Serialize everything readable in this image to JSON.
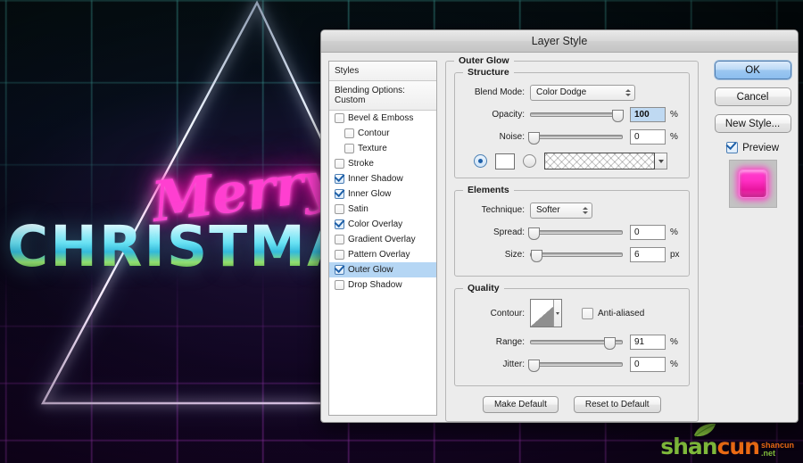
{
  "artwork": {
    "script_text": "Merry",
    "block_text": "CHRISTMAS",
    "colors": {
      "neon_pink": "#ff3fd0",
      "neon_cyan": "#5aebe1",
      "neon_purple": "#cd46eb"
    }
  },
  "watermark": {
    "part1": "shan",
    "part2": "cun",
    "domain_line1": "shancun",
    "domain_line2": ".net"
  },
  "dialog": {
    "title": "Layer Style",
    "styles_panel": {
      "header": "Styles",
      "blending_options": "Blending Options: Custom",
      "items": [
        {
          "label": "Bevel & Emboss",
          "checked": false,
          "indent": false,
          "selected": false
        },
        {
          "label": "Contour",
          "checked": false,
          "indent": true,
          "selected": false
        },
        {
          "label": "Texture",
          "checked": false,
          "indent": true,
          "selected": false
        },
        {
          "label": "Stroke",
          "checked": false,
          "indent": false,
          "selected": false
        },
        {
          "label": "Inner Shadow",
          "checked": true,
          "indent": false,
          "selected": false
        },
        {
          "label": "Inner Glow",
          "checked": true,
          "indent": false,
          "selected": false
        },
        {
          "label": "Satin",
          "checked": false,
          "indent": false,
          "selected": false
        },
        {
          "label": "Color Overlay",
          "checked": true,
          "indent": false,
          "selected": false
        },
        {
          "label": "Gradient Overlay",
          "checked": false,
          "indent": false,
          "selected": false
        },
        {
          "label": "Pattern Overlay",
          "checked": false,
          "indent": false,
          "selected": false
        },
        {
          "label": "Outer Glow",
          "checked": true,
          "indent": false,
          "selected": true
        },
        {
          "label": "Drop Shadow",
          "checked": false,
          "indent": false,
          "selected": false
        }
      ]
    },
    "effect": {
      "title": "Outer Glow",
      "structure": {
        "legend": "Structure",
        "blend_mode_label": "Blend Mode:",
        "blend_mode_value": "Color Dodge",
        "opacity_label": "Opacity:",
        "opacity_value": "100",
        "opacity_unit": "%",
        "noise_label": "Noise:",
        "noise_value": "0",
        "noise_unit": "%"
      },
      "elements": {
        "legend": "Elements",
        "technique_label": "Technique:",
        "technique_value": "Softer",
        "spread_label": "Spread:",
        "spread_value": "0",
        "spread_unit": "%",
        "size_label": "Size:",
        "size_value": "6",
        "size_unit": "px"
      },
      "quality": {
        "legend": "Quality",
        "contour_label": "Contour:",
        "antialiased_label": "Anti-aliased",
        "antialiased_checked": false,
        "range_label": "Range:",
        "range_value": "91",
        "range_unit": "%",
        "jitter_label": "Jitter:",
        "jitter_value": "0",
        "jitter_unit": "%"
      },
      "make_default": "Make Default",
      "reset_to_default": "Reset to Default"
    },
    "buttons": {
      "ok": "OK",
      "cancel": "Cancel",
      "new_style": "New Style...",
      "preview_label": "Preview",
      "preview_checked": true
    }
  }
}
